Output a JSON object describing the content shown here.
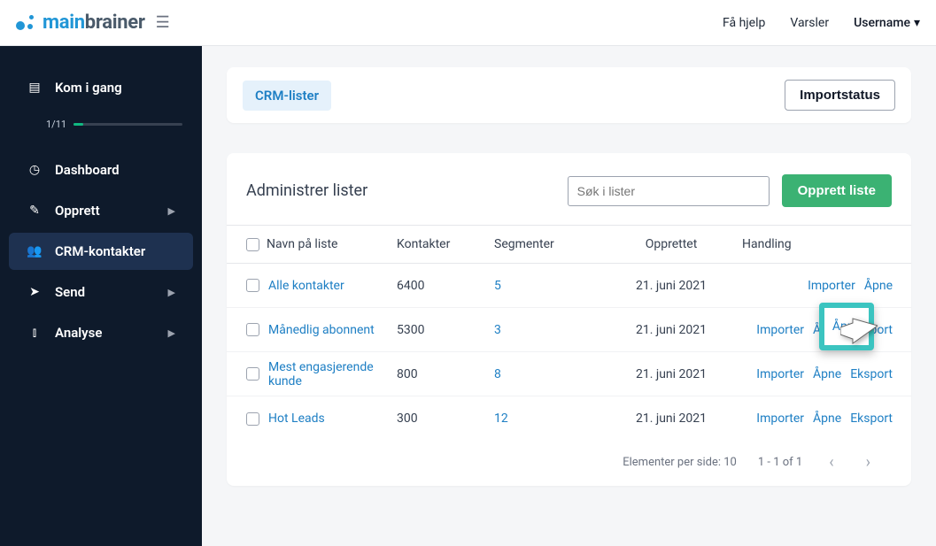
{
  "topbar": {
    "logo_main": "main",
    "logo_brainer": "brainer",
    "help": "Få hjelp",
    "alerts": "Varsler",
    "username": "Username"
  },
  "sidebar": {
    "getstarted": "Kom i gang",
    "progress": "1/11",
    "items": [
      {
        "icon": "gauge",
        "label": "Dashboard",
        "arrow": false
      },
      {
        "icon": "pencil",
        "label": "Opprett",
        "arrow": true
      },
      {
        "icon": "users",
        "label": "CRM-kontakter",
        "arrow": false,
        "active": true
      },
      {
        "icon": "plane",
        "label": "Send",
        "arrow": true
      },
      {
        "icon": "chart",
        "label": "Analyse",
        "arrow": true
      }
    ]
  },
  "tabs": {
    "lists": "CRM-lister",
    "importstatus": "Importstatus"
  },
  "table": {
    "title": "Administrer lister",
    "search_placeholder": "Søk i lister",
    "create": "Opprett liste",
    "columns": {
      "name": "Navn på liste",
      "contacts": "Kontakter",
      "segments": "Segmenter",
      "created": "Opprettet",
      "actions": "Handling"
    },
    "action_labels": {
      "import": "Importer",
      "open": "Åpne",
      "export": "Eksport"
    },
    "rows": [
      {
        "name": "Alle kontakter",
        "contacts": "6400",
        "segments": "5",
        "created": "21. juni 2021",
        "has_export": false
      },
      {
        "name": "Månedlig abonnent",
        "contacts": "5300",
        "segments": "3",
        "created": "21. juni 2021",
        "has_export": true,
        "highlight": true
      },
      {
        "name": "Mest engasjerende kunde",
        "contacts": "800",
        "segments": "8",
        "created": "21. juni 2021",
        "has_export": true
      },
      {
        "name": "Hot Leads",
        "contacts": "300",
        "segments": "12",
        "created": "21. juni 2021",
        "has_export": true
      }
    ],
    "pager": {
      "per_side": "Elementer per side: 10",
      "range": "1 - 1 of 1"
    }
  }
}
